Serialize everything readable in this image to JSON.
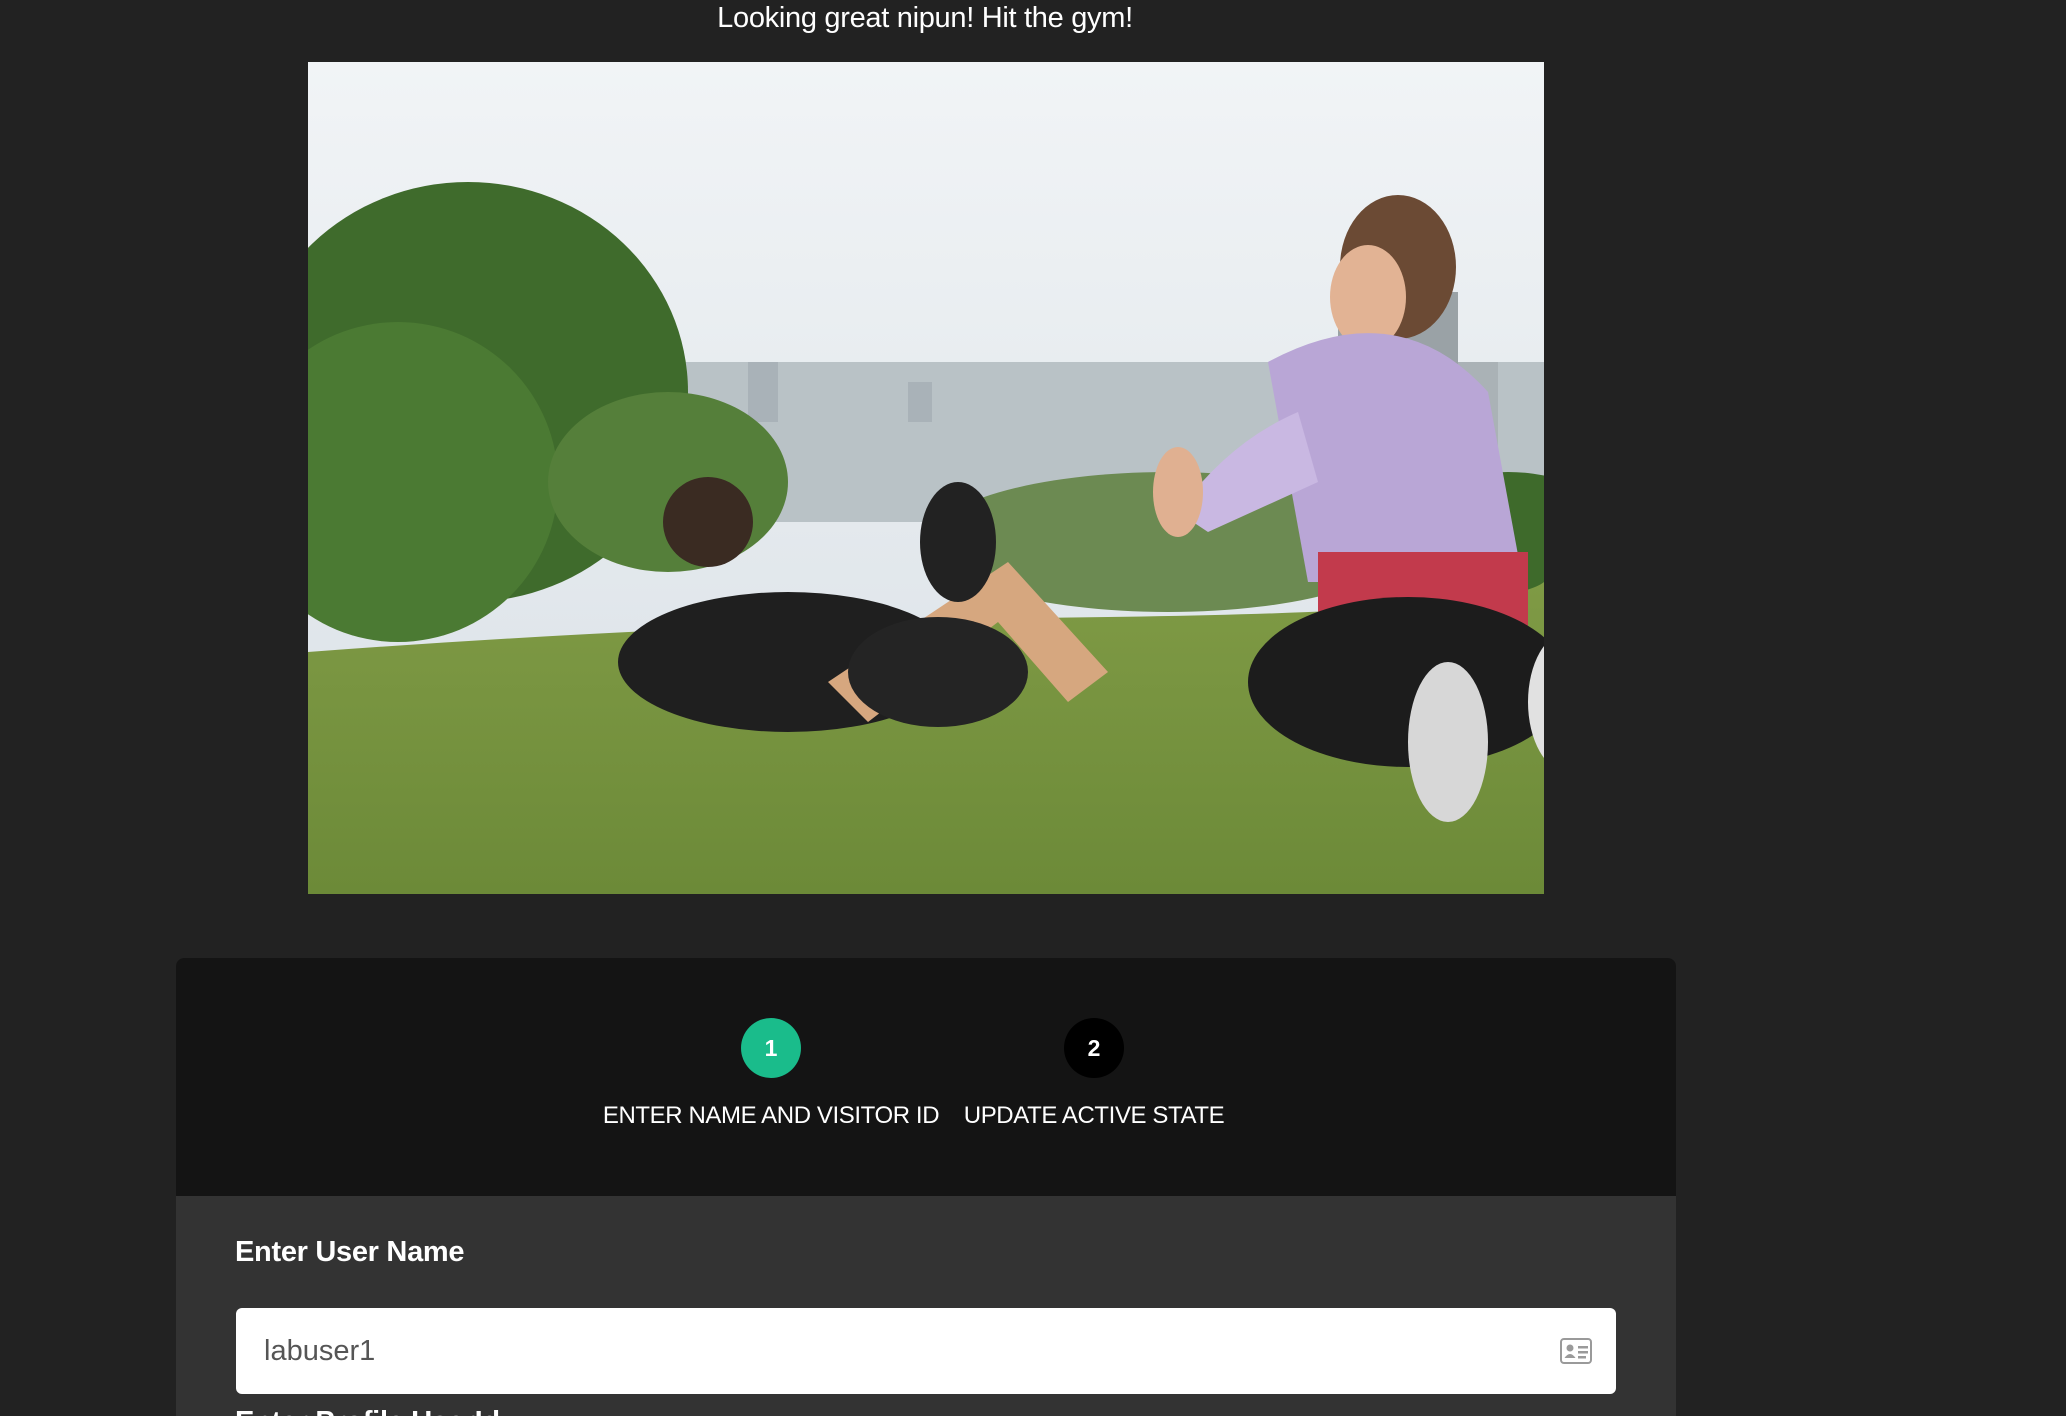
{
  "header": {
    "message": "Looking great nipun! Hit the gym!"
  },
  "hero": {
    "image": "outdoor-workout-photo"
  },
  "wizard": {
    "steps": [
      {
        "number": "1",
        "label": "ENTER NAME AND VISITOR ID",
        "state": "active"
      },
      {
        "number": "2",
        "label": "UPDATE ACTIVE STATE",
        "state": "idle"
      }
    ],
    "fields": {
      "username_label": "Enter User Name",
      "username_value": "labuser1",
      "username_icon": "id-card-icon",
      "profile_label": "Enter Profile UserId"
    }
  },
  "colors": {
    "background": "#222222",
    "wizard_header": "#141414",
    "wizard_body": "#333333",
    "active_step": "#1abc8b",
    "idle_step": "#000000"
  }
}
